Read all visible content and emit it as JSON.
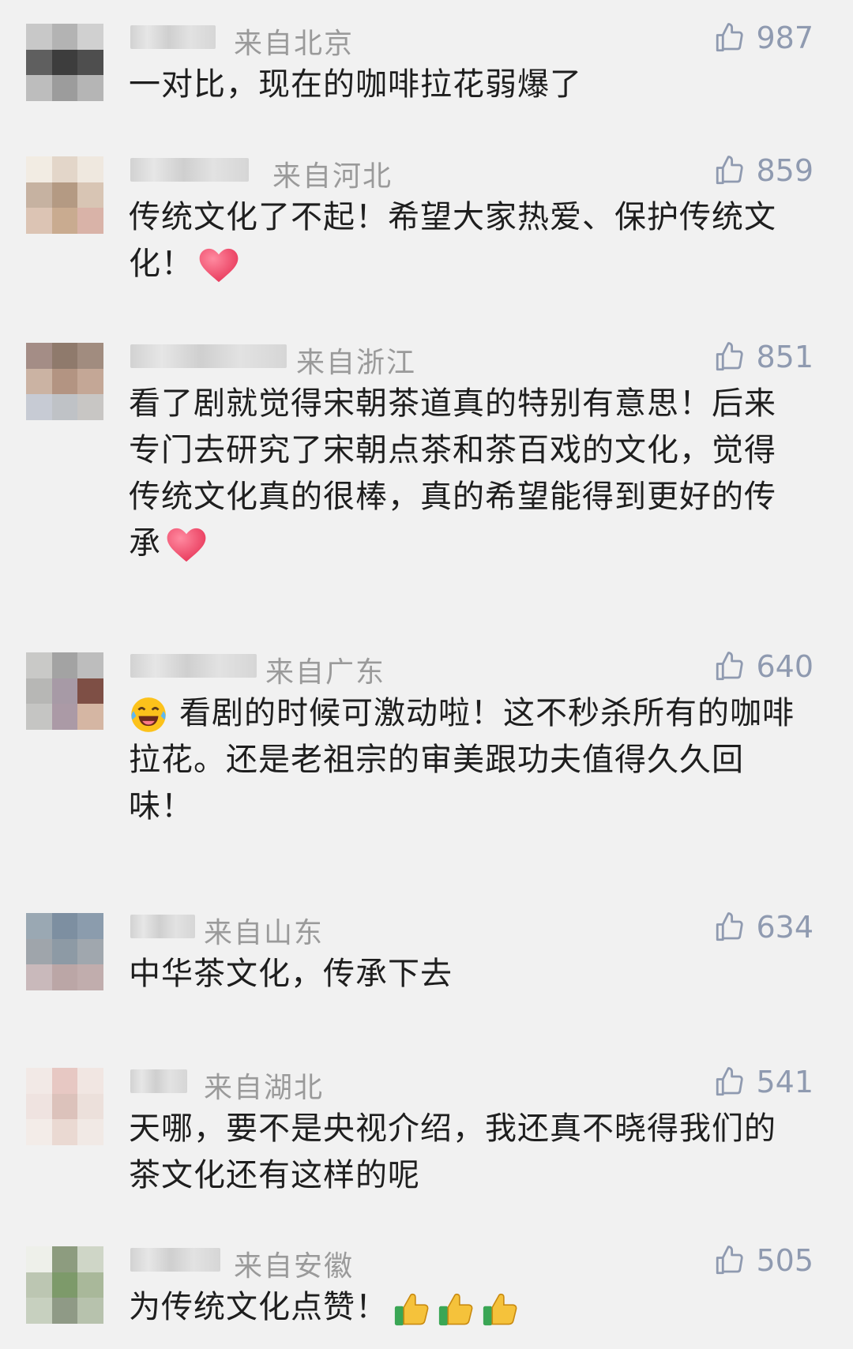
{
  "comments": [
    {
      "location": "来自北京",
      "likes": "987",
      "text": "一对比，现在的咖啡拉花弱爆了",
      "avatar_colors": [
        "#c8c8c8",
        "#b3b3b3",
        "#d0d0d0",
        "#5f5f5f",
        "#3d3d3d",
        "#4e4e4e",
        "#bdbdbd",
        "#9c9c9c",
        "#b5b5b5"
      ]
    },
    {
      "location": "来自河北",
      "likes": "859",
      "text": "传统文化了不起！希望大家热爱、保护传统文化！",
      "avatar_colors": [
        "#f2ece3",
        "#e3d6c9",
        "#efe8df",
        "#c6b2a1",
        "#b49a83",
        "#d8c5b4",
        "#dcc4b4",
        "#c9ab90",
        "#d9b3a8"
      ]
    },
    {
      "location": "来自浙江",
      "likes": "851",
      "text": "看了剧就觉得宋朝茶道真的特别有意思！后来专门去研究了宋朝点茶和茶百戏的文化，觉得传统文化真的很棒，真的希望能得到更好的传承",
      "avatar_colors": [
        "#a48d86",
        "#8f7a6c",
        "#a18c7f",
        "#cbb3a3",
        "#b39482",
        "#c4a796",
        "#c7cbd4",
        "#bfc2c6",
        "#c8c6c4"
      ]
    },
    {
      "location": "来自广东",
      "likes": "640",
      "text": "看剧的时候可激动啦！这不秒杀所有的咖啡拉花。还是老祖宗的审美跟功夫值得久久回味！",
      "avatar_colors": [
        "#c9c9c7",
        "#a3a3a3",
        "#bdbdbd",
        "#b7b7b5",
        "#a79aa6",
        "#7e4f45",
        "#c5c5c3",
        "#ab9aa6",
        "#d5b6a3"
      ]
    },
    {
      "location": "来自山东",
      "likes": "634",
      "text": "中华茶文化，传承下去",
      "avatar_colors": [
        "#9aa8b3",
        "#7d8fa1",
        "#8b9cad",
        "#9fa5ab",
        "#8d9aa5",
        "#a0a7ae",
        "#c9b9bb",
        "#bba6a6",
        "#c1adad"
      ]
    },
    {
      "location": "来自湖北",
      "likes": "541",
      "text": "天哪，要不是央视介绍，我还真不晓得我们的茶文化还有这样的呢",
      "avatar_colors": [
        "#f2e9e6",
        "#e7c8c3",
        "#f1e6e2",
        "#efe3e0",
        "#dcc2bb",
        "#ece0db",
        "#f3ece8",
        "#ead9d2",
        "#f1e9e5"
      ]
    },
    {
      "location": "来自安徽",
      "likes": "505",
      "text": "为传统文化点赞！",
      "avatar_colors": [
        "#eef0ea",
        "#8d9c7f",
        "#cfd6c7",
        "#bcc6b2",
        "#7d9a6a",
        "#a9b89a",
        "#c7d0bf",
        "#8f9a86",
        "#b7c2ad"
      ]
    }
  ],
  "icons": {
    "like": "thumbs-up-outline-icon",
    "heart": "red-heart-emoji",
    "laugh": "laughing-tears-emoji",
    "thumb": "thumbs-up-emoji"
  },
  "colors": {
    "background": "#f1f1f1",
    "location": "#9a9a9a",
    "like_count": "#8f9ab0",
    "text": "#1e1e1e"
  }
}
